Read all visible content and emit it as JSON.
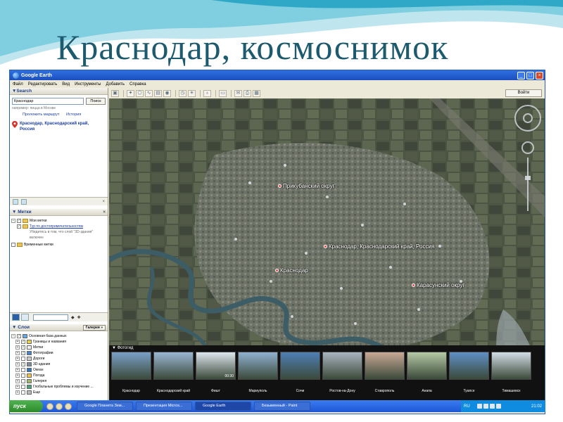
{
  "slide": {
    "title": "Краснодар, космоснимок"
  },
  "window": {
    "title": "Google Earth"
  },
  "menu": [
    "Файл",
    "Редактировать",
    "Вид",
    "Инструменты",
    "Добавить",
    "Справка"
  ],
  "toolbar": {
    "signin_label": "Войти"
  },
  "search": {
    "header": "▼Search",
    "query": "Краснодар",
    "button": "Поиск",
    "hint": "например: пицца в Москве",
    "link_route": "Проложить маршрут",
    "link_history": "История",
    "result": "Краснодар, Краснодарский край, Россия"
  },
  "places": {
    "header": "▼ Метки",
    "my_places": "Мои метки",
    "tour_link": "Тур по достопримечательностям",
    "tour_note": "Убедитесь в том, что слой \"3D-здания\" включен",
    "temp_places": "Временные метки"
  },
  "layers": {
    "header": "▼ Слои",
    "gallery_button": "Галерея »",
    "items": [
      "Основная база данных",
      "Границы и названия",
      "Метки",
      "Фотографии",
      "Дороги",
      "3D-здания",
      "Океан",
      "Погода",
      "Галерея",
      "Глобальные проблемы и изучение ...",
      "Еще"
    ]
  },
  "map": {
    "labels": {
      "prikuban": "Прикубанский округ",
      "krasnodar_full": "Краснодар, Краснодарский край, Россия",
      "krasnodar": "Краснодар",
      "karasun": "Карасунский округ"
    }
  },
  "photos": {
    "header": "▼ Фотогид",
    "captions": [
      "Краснодар",
      "Краснодарский край",
      "Фишт",
      "Мариуполь",
      "Сочи",
      "Ростов-на-Дону",
      "Ставрополь",
      "Анапа",
      "Туапсе",
      "Тимашевск"
    ],
    "durations": [
      "",
      "",
      "00:30",
      "",
      "",
      "",
      "",
      "",
      "",
      ""
    ],
    "colors": [
      "#7aa0c8",
      "#9bb6d4",
      "#dfe6ee",
      "#8fb0d0",
      "#4f7fb5",
      "#a9b4bf",
      "#c9a896",
      "#b4c9a5",
      "#5f8fc6",
      "#d3dde6"
    ]
  },
  "taskbar": {
    "start": "пуск",
    "tasks": [
      "Google Планета Зем...",
      "Презентация Micros...",
      "Google Earth",
      "Безымянный - Paint"
    ],
    "lang": "RU",
    "clock": "21:02"
  }
}
